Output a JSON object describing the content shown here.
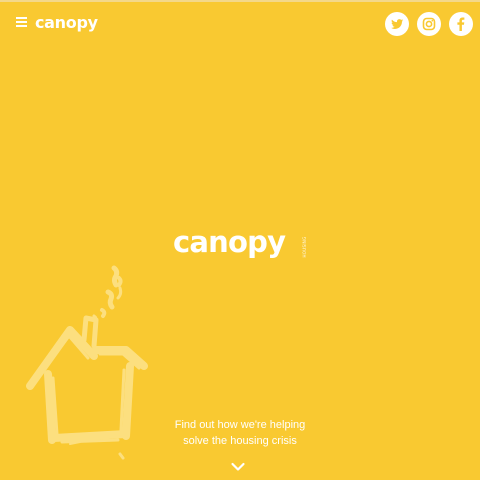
{
  "colors": {
    "background": "#f9c931",
    "foreground": "#ffffff"
  },
  "header": {
    "menu_icon": "hamburger-menu-icon",
    "logo_text": "canopy",
    "social": [
      {
        "name": "Twitter",
        "icon": "twitter-icon"
      },
      {
        "name": "Instagram",
        "icon": "instagram-icon"
      },
      {
        "name": "Facebook",
        "icon": "facebook-icon"
      }
    ]
  },
  "hero": {
    "logo_text": "canopy",
    "logo_tag": "HOUSING",
    "illustration": "house-sketch-illustration"
  },
  "cta": {
    "line1": "Find out how we're helping",
    "line2": "solve the housing crisis",
    "scroll_icon": "chevron-down-icon"
  }
}
